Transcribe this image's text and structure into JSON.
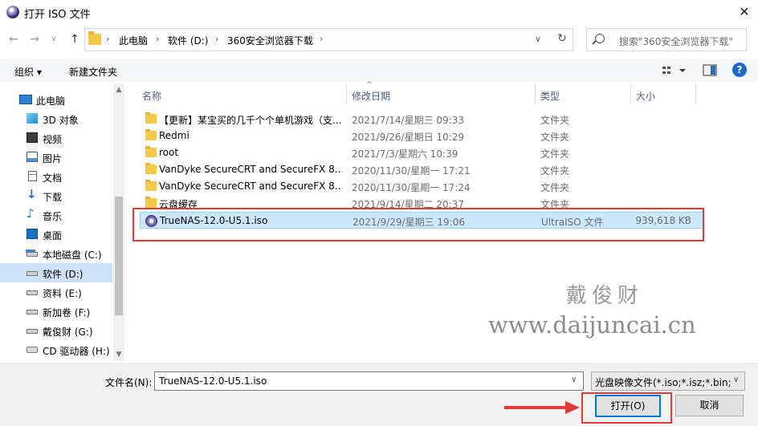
{
  "window": {
    "title": "打开 ISO 文件",
    "close": "✕"
  },
  "nav": {
    "back": "←",
    "forward": "→",
    "recent": "∨",
    "up": "↑",
    "breadcrumb": [
      "此电脑",
      "软件 (D:)",
      "360安全浏览器下载"
    ],
    "crumb_sep": "›",
    "search_placeholder": "搜索\"360安全浏览器下载\""
  },
  "toolbar": {
    "organize": "组织 ▾",
    "new_folder": "新建文件夹",
    "help": "?"
  },
  "sidebar": {
    "items": [
      {
        "label": "此电脑",
        "icon": "computer-icon"
      },
      {
        "label": "3D 对象",
        "icon": "3d-objects-icon"
      },
      {
        "label": "视频",
        "icon": "video-icon"
      },
      {
        "label": "图片",
        "icon": "pictures-icon"
      },
      {
        "label": "文档",
        "icon": "documents-icon"
      },
      {
        "label": "下载",
        "icon": "download-icon"
      },
      {
        "label": "音乐",
        "icon": "music-icon"
      },
      {
        "label": "桌面",
        "icon": "desktop-icon"
      },
      {
        "label": "本地磁盘 (C:)",
        "icon": "drive-icon"
      },
      {
        "label": "软件 (D:)",
        "icon": "drive-icon",
        "selected": true
      },
      {
        "label": "资料 (E:)",
        "icon": "drive-icon"
      },
      {
        "label": "新加卷 (F:)",
        "icon": "drive-icon"
      },
      {
        "label": "戴俊财 (G:)",
        "icon": "drive-icon"
      },
      {
        "label": "CD 驱动器 (H:)",
        "icon": "cd-drive-icon"
      }
    ]
  },
  "columns": {
    "name": "名称",
    "modified": "修改日期",
    "type": "类型",
    "size": "大小"
  },
  "files": [
    {
      "name": "【更新】某宝买的几千个个单机游戏（支...",
      "modified": "2021/7/14/星期三 09:33",
      "type": "文件夹",
      "size": ""
    },
    {
      "name": "Redmi",
      "modified": "2021/9/26/星期日 10:29",
      "type": "文件夹",
      "size": ""
    },
    {
      "name": "root",
      "modified": "2021/7/3/星期六 10:39",
      "type": "文件夹",
      "size": ""
    },
    {
      "name": "VanDyke SecureCRT and SecureFX 8....",
      "modified": "2020/11/30/星期一 17:21",
      "type": "文件夹",
      "size": ""
    },
    {
      "name": "VanDyke SecureCRT and SecureFX 8....",
      "modified": "2020/11/30/星期一 17:24",
      "type": "文件夹",
      "size": ""
    },
    {
      "name": "云盘缓存",
      "modified": "2021/9/14/星期二 20:37",
      "type": "文件夹",
      "size": ""
    },
    {
      "name": "TrueNAS-12.0-U5.1.iso",
      "modified": "2021/9/29/星期三 19:06",
      "type": "UltraISO 文件",
      "size": "939,618 KB",
      "selected": true
    }
  ],
  "watermark": {
    "name": "戴俊财",
    "url": "www.daijuncai.cn"
  },
  "bottom": {
    "filename_label": "文件名(N):",
    "filename_value": "TrueNAS-12.0-U5.1.iso",
    "filetype_value": "光盘映像文件(*.iso;*.isz;*.bin;*",
    "open": "打开(O)",
    "cancel": "取消"
  },
  "colors": {
    "accent": "#0078d7",
    "selection": "#cce8ff",
    "highlight_red": "#e03a3a"
  }
}
